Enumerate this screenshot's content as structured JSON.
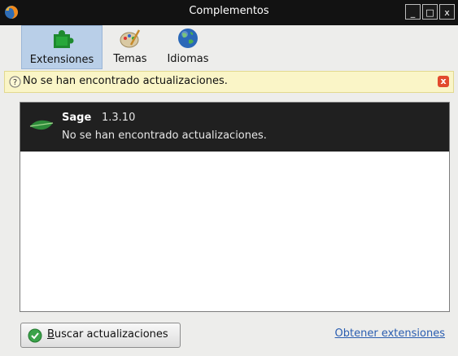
{
  "window": {
    "title": "Complementos",
    "controls": {
      "minimize": "_",
      "maximize": "□",
      "close": "x"
    }
  },
  "toolbar": {
    "buttons": [
      {
        "label": "Extensiones",
        "icon": "puzzle-icon",
        "selected": true
      },
      {
        "label": "Temas",
        "icon": "palette-icon",
        "selected": false
      },
      {
        "label": "Idiomas",
        "icon": "globe-icon",
        "selected": false
      }
    ]
  },
  "notification": {
    "message": "No se han encontrado actualizaciones.",
    "close_label": "x",
    "color": "#faf5c7"
  },
  "extensions": [
    {
      "name": "Sage",
      "version": "1.3.10",
      "status": "No se han encontrado actualizaciones.",
      "icon": "leaf-icon"
    }
  ],
  "footer": {
    "find_button_first": "B",
    "find_button_rest": "uscar actualizaciones",
    "get_extensions_label": "Obtener extensiones"
  },
  "colors": {
    "titlebar": "#121212",
    "selected_tab": "#b9cfe8",
    "selected_item": "#202020",
    "link": "#2a5db0"
  }
}
